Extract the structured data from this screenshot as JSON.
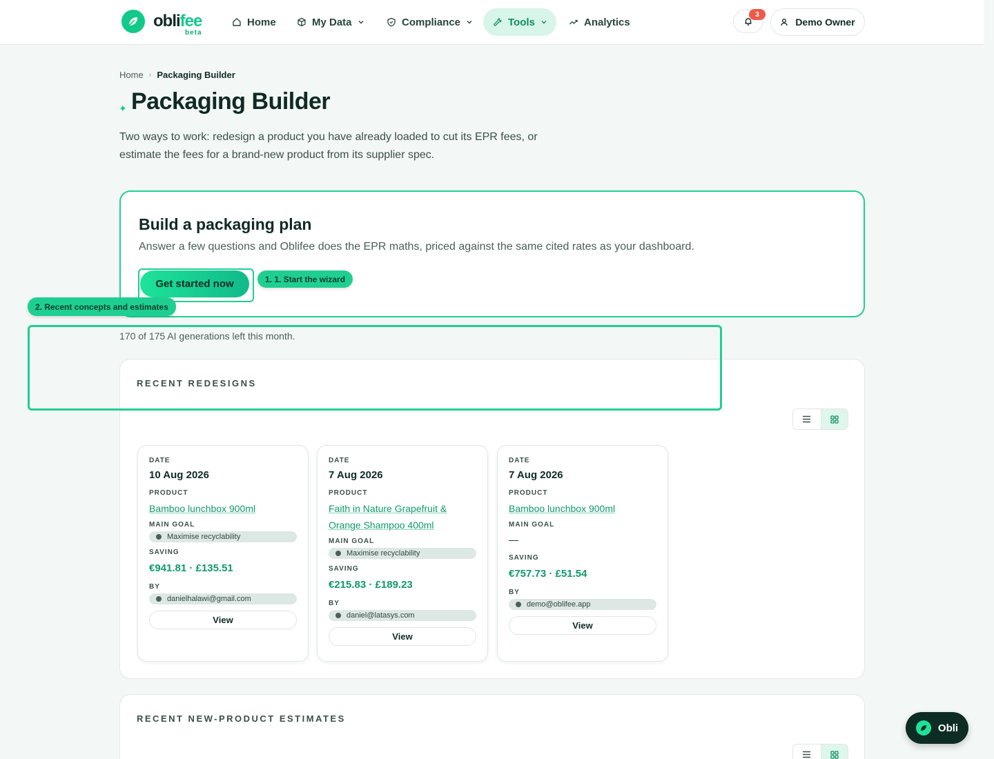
{
  "brand": {
    "name_a": "obli",
    "name_b": "fee",
    "badge": "beta"
  },
  "nav": [
    {
      "label": "Home",
      "icon": "home-icon"
    },
    {
      "label": "My Data",
      "icon": "box-icon"
    },
    {
      "label": "Compliance",
      "icon": "shield-icon"
    },
    {
      "label": "Tools",
      "icon": "wrench-icon",
      "active": true
    },
    {
      "label": "Analytics",
      "icon": "trend-icon"
    }
  ],
  "header": {
    "notification_count": "3",
    "user_name": "Demo Owner"
  },
  "breadcrumb": {
    "home": "Home",
    "sep": "›",
    "current": "Packaging Builder"
  },
  "page": {
    "spark": "✦",
    "title": "Packaging Builder",
    "description": "Two ways to work: redesign a product you have already loaded to cut its EPR fees, or estimate the fees for a brand-new product from its supplier spec."
  },
  "plan": {
    "title": "Build a packaging plan",
    "description": "Answer a few questions and Oblifee does the EPR maths, priced against the same cited rates as your dashboard.",
    "cta": "Get started now"
  },
  "tour": {
    "step1": "1. 1. Start the wizard",
    "step2": "2. Recent concepts and estimates"
  },
  "generations_left": "170 of 175 AI generations left this month.",
  "recent_redesigns": {
    "title": "RECENT REDESIGNS",
    "labels": {
      "date": "DATE",
      "product": "PRODUCT",
      "goal": "MAIN GOAL",
      "saving": "SAVING",
      "by": "BY",
      "view": "View"
    },
    "items": [
      {
        "date": "10 Aug 2026",
        "product": "Bamboo lunchbox 900ml",
        "goal": "Maximise recyclability",
        "saving": "€941.81 · £135.51",
        "by": "danielhalawi@gmail.com"
      },
      {
        "date": "7 Aug 2026",
        "product": "Faith in Nature Grapefruit & Orange Shampoo 400ml",
        "goal": "Maximise recyclability",
        "saving": "€215.83 · £189.23",
        "by": "daniel@latasys.com"
      },
      {
        "date": "7 Aug 2026",
        "product": "Bamboo lunchbox 900ml",
        "goal": "—",
        "saving": "€757.73 · £51.54",
        "by": "demo@oblifee.app"
      }
    ]
  },
  "recent_estimates": {
    "title": "RECENT NEW-PRODUCT ESTIMATES"
  },
  "assistant": {
    "label": "Obli"
  },
  "colors": {
    "accent": "#12c98a",
    "accent_dark": "#0f9a6a",
    "ink": "#0f2a24",
    "badge": "#ee5a4a",
    "bg": "#f3f7f5"
  }
}
